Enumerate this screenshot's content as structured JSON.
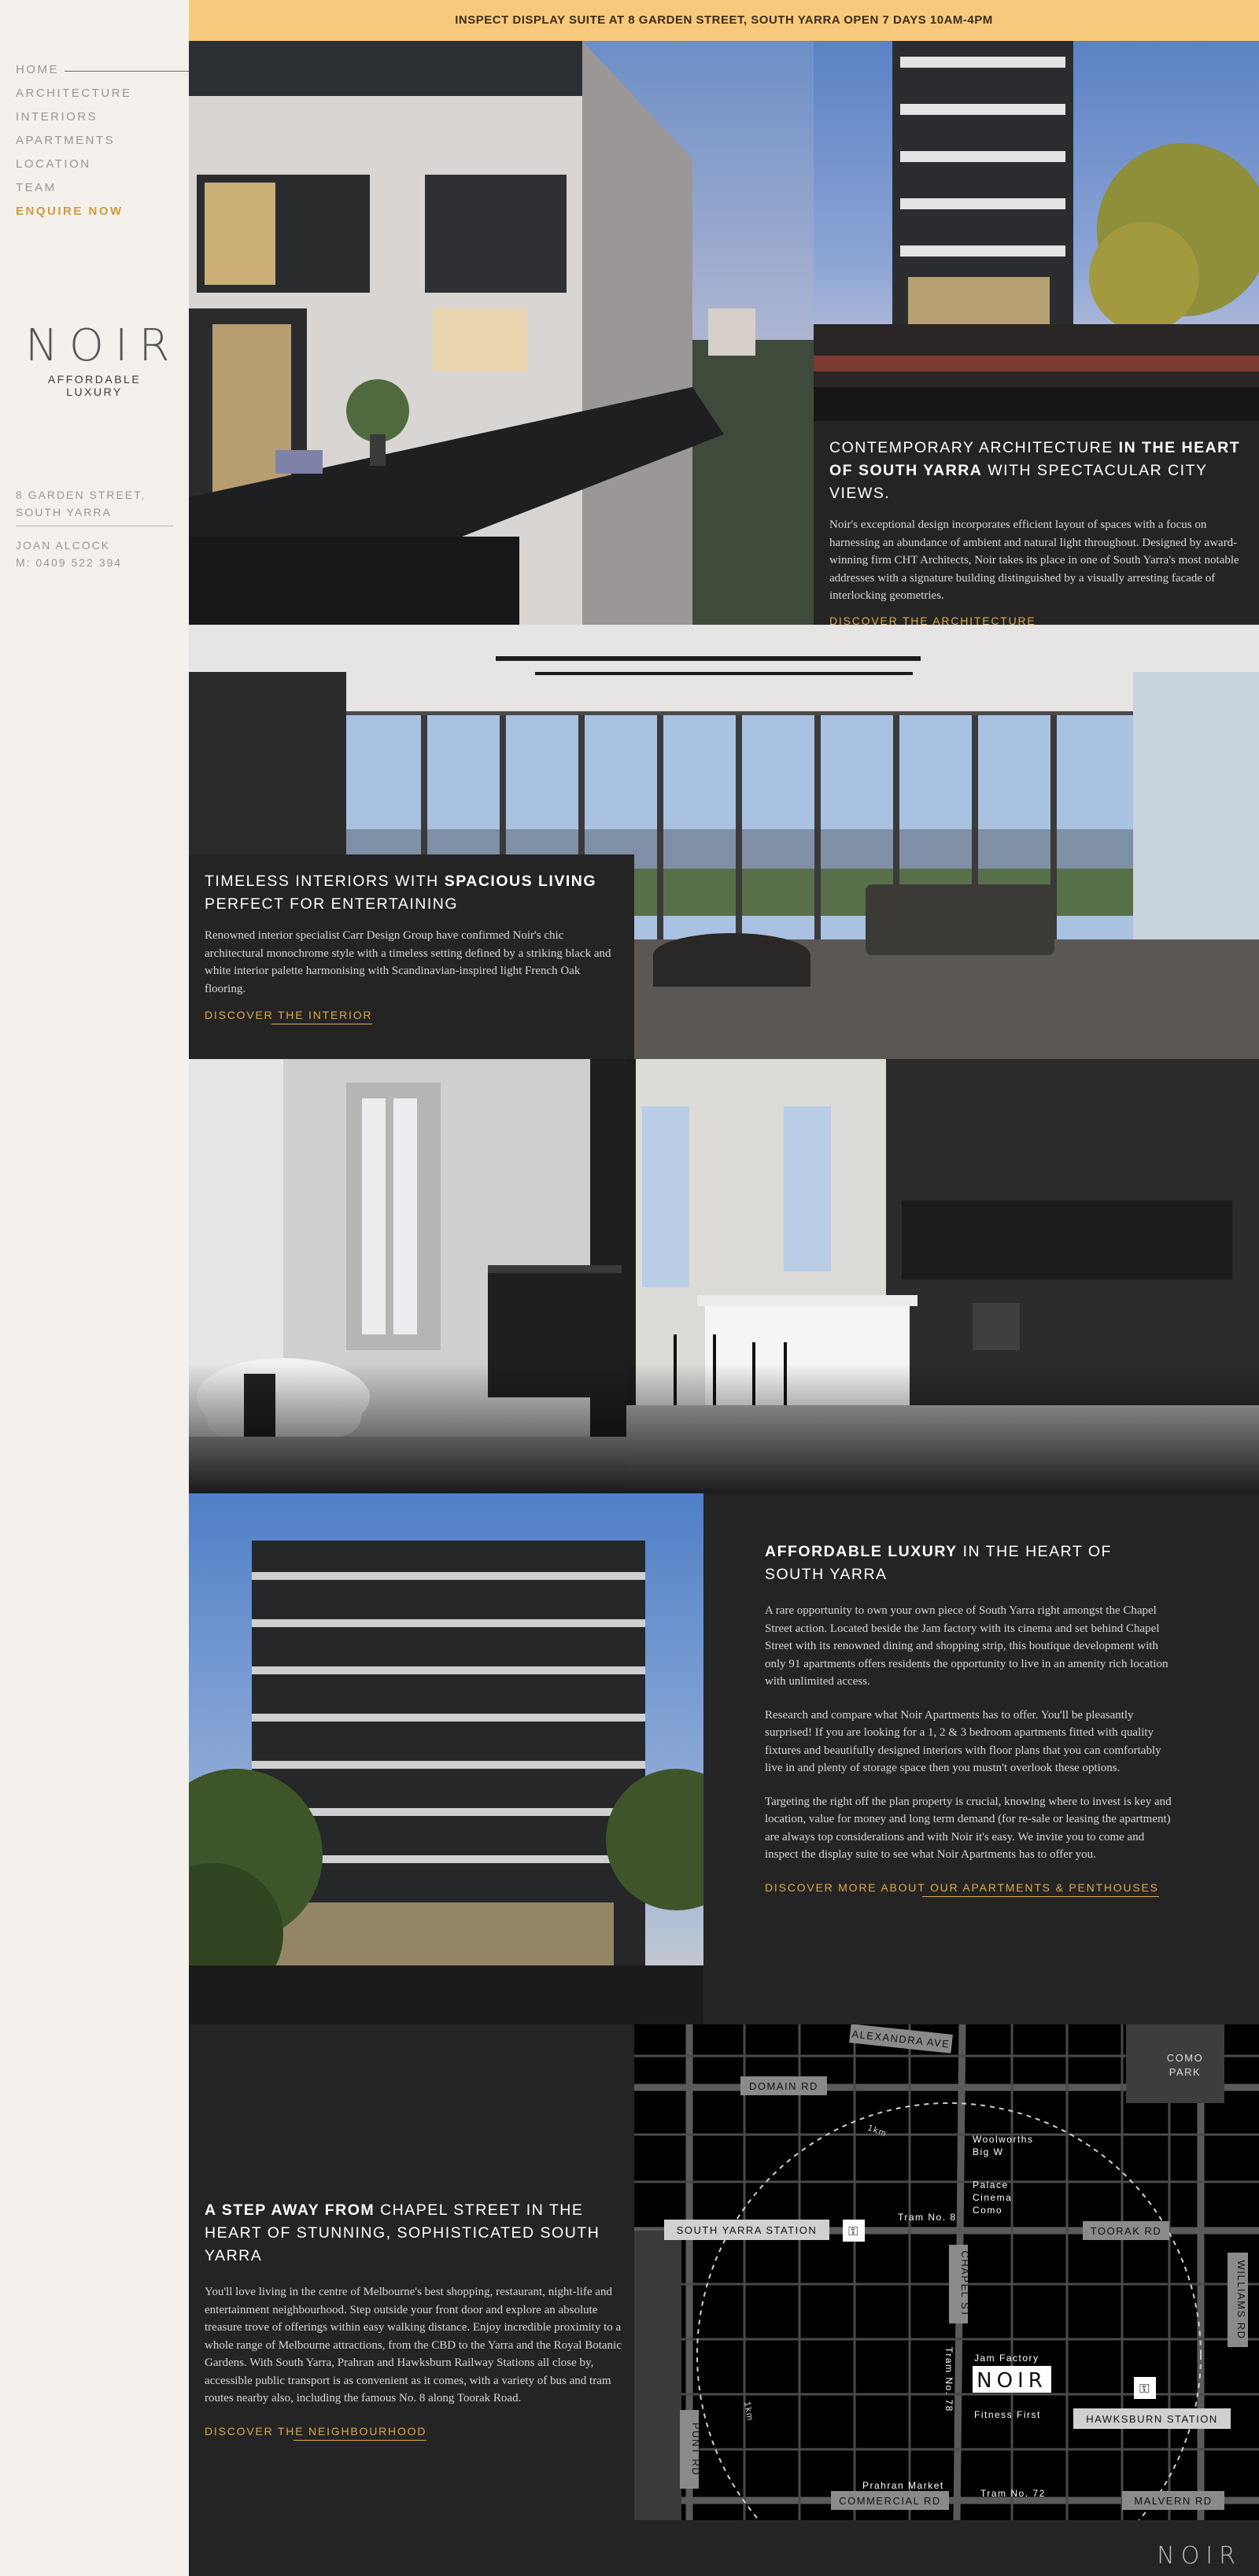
{
  "banner": {
    "text": "INSPECT DISPLAY SUITE AT 8 GARDEN STREET, SOUTH YARRA OPEN 7 DAYS 10AM-4PM"
  },
  "nav": {
    "items": [
      {
        "label": "HOME"
      },
      {
        "label": "ARCHITECTURE"
      },
      {
        "label": "INTERIORS"
      },
      {
        "label": "APARTMENTS"
      },
      {
        "label": "LOCATION"
      },
      {
        "label": "TEAM"
      }
    ],
    "enquire": "ENQUIRE NOW"
  },
  "logo": {
    "word": "NOIR",
    "tagline": "AFFORDABLE LUXURY"
  },
  "address": {
    "line1": "8 GARDEN STREET,",
    "line2": "SOUTH YARRA"
  },
  "contact": {
    "name": "JOAN ALCOCK",
    "phone": "M: 0409 522 394"
  },
  "architecture": {
    "heading_pre": "CONTEMPORARY ARCHITECTURE ",
    "heading_bold": "IN THE HEART OF SOUTH YARRA",
    "heading_post": " WITH SPECTACULAR CITY VIEWS.",
    "body": "Noir's exceptional design incorporates efficient layout of spaces with a focus on harnessing an abundance of ambient and natural light throughout. Designed by award-winning firm CHT Architects, Noir takes its place in one of South Yarra's most notable addresses with a signature building distinguished by a visually arresting facade of interlocking geometries.",
    "link": "DISCOVER THE ARCHITECTURE"
  },
  "interiors": {
    "heading_pre": "TIMELESS INTERIORS WITH ",
    "heading_bold": "SPACIOUS LIVING",
    "heading_post": " PERFECT FOR ENTERTAINING",
    "body": "Renowned interior specialist Carr Design Group have confirmed Noir's chic architectural monochrome style with a timeless setting defined by a striking black and white interior palette harmonising with Scandinavian-inspired light French Oak flooring.",
    "link": "DISCOVER THE INTERIOR"
  },
  "apartments": {
    "heading_bold": "AFFORDABLE LUXURY",
    "heading_post": " IN THE HEART OF SOUTH YARRA",
    "p1": "A rare opportunity to own your own piece of South Yarra right amongst the Chapel Street action. Located beside the Jam factory with its cinema and set behind Chapel Street with its renowned dining and shopping strip, this boutique development with only 91 apartments offers residents the opportunity to live in an amenity rich location with unlimited access.",
    "p2": "Research and compare what Noir Apartments has to offer. You'll be pleasantly surprised! If you are looking for a 1, 2 & 3 bedroom apartments fitted with quality fixtures and beautifully designed interiors with floor plans that you can comfortably live in and plenty of storage space then you mustn't overlook these options.",
    "p3": "Targeting the right off the plan property is crucial, knowing where to invest is key and location, value for money and long term demand (for re-sale or leasing the apartment) are always top considerations and with Noir it's easy. We invite you to come and inspect the display suite to see what Noir Apartments has to offer you.",
    "link": "DISCOVER MORE ABOUT OUR APARTMENTS & PENTHOUSES"
  },
  "location": {
    "heading_bold": "A STEP AWAY FROM",
    "heading_post": " CHAPEL STREET IN THE HEART OF STUNNING, SOPHISTICATED SOUTH YARRA",
    "body": "You'll love living in the centre of Melbourne's best shopping, restaurant, night-life and entertainment neighbourhood. Step outside your front door and explore an absolute treasure trove of offerings within easy walking distance. Enjoy incredible proximity to a whole range of Melbourne attractions, from the CBD to the Yarra and the Royal Botanic Gardens. With South Yarra, Prahran and Hawksburn Railway Stations all close by, accessible public transport is as convenient as it comes, with a variety of bus and tram routes nearby also, including the famous No. 8 along Toorak Road.",
    "link": "DISCOVER THE NEIGHBOURHOOD"
  },
  "map": {
    "alexandra": "ALEXANDRA AVE",
    "domain": "DOMAIN RD",
    "como1": "COMO",
    "como2": "PARK",
    "south_yarra": "SOUTH YARRA STATION",
    "woolworths1": "Woolworths",
    "woolworths2": "Big W",
    "palace1": "Palace",
    "palace2": "Cinema",
    "palace3": "Como",
    "tram8": "Tram No. 8",
    "toorak": "TOORAK RD",
    "km1": "1km",
    "chapel": "CHAPEL ST",
    "williams": "WILLIAMS RD",
    "jam": "Jam Factory",
    "noir": "NOIR",
    "tram78": "Tram No. 78",
    "fitness": "Fitness First",
    "hawksburn": "HAWKSBURN STATION",
    "km2": "1km",
    "punt": "PUNT RD",
    "prahran": "Prahran Market",
    "commercial": "COMMERCIAL RD",
    "tram72": "Tram No. 72",
    "malvern": "MALVERN RD"
  },
  "footer_logo": "NOIR"
}
